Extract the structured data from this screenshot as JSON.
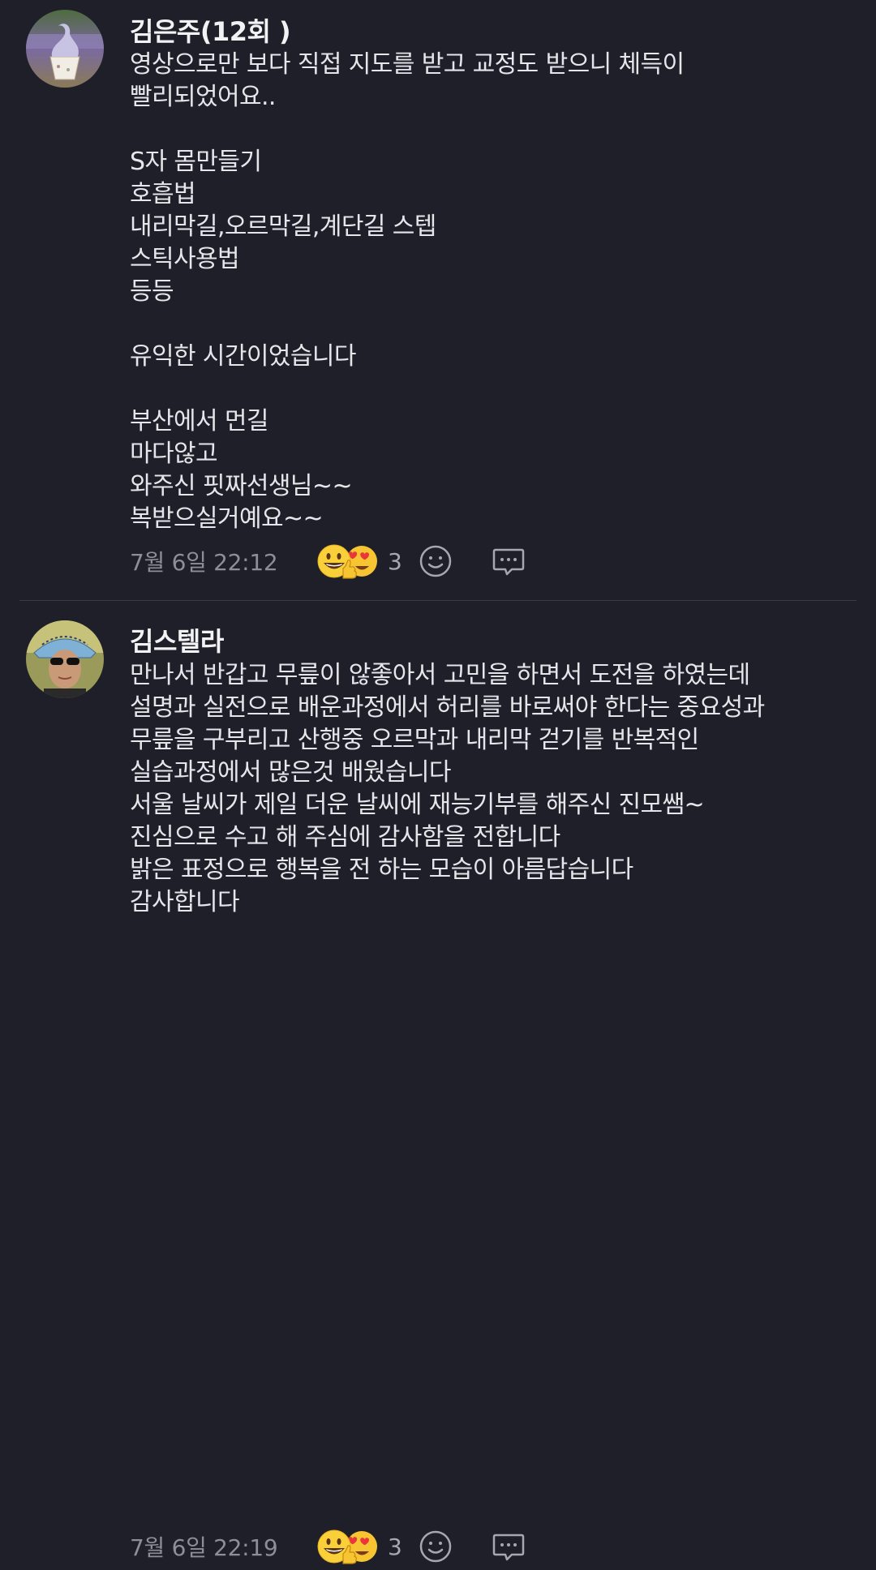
{
  "comments": [
    {
      "author": "김은주(12회 )",
      "lines": [
        "영상으로만 보다 직접 지도를 받고 교정도 받으니 체득이",
        "빨리되었어요..",
        "",
        "S자 몸만들기",
        "호흡법",
        "내리막길,오르막길,계단길 스텝",
        "스틱사용법",
        "등등",
        "",
        "유익한 시간이었습니다",
        "",
        "부산에서 먼길",
        "마다않고",
        "와주신 핏짜선생님~~",
        "복받으실거예요~~"
      ],
      "timestamp": "7월 6일 22:12",
      "reaction_count": "3",
      "reaction_icons": [
        "grinning-emoji",
        "thumbs-up-emoji",
        "heart-eyes-emoji"
      ],
      "actions": [
        "add-reaction-icon",
        "reply-icon"
      ]
    },
    {
      "author": "김스텔라",
      "lines": [
        "만나서 반갑고 무릎이  않좋아서 고민을 하면서 도전을 하였는데",
        "설명과 실전으로 배운과정에서 허리를 바로써야 한다는 중요성과",
        "무릎을 구부리고 산행중 오르막과  내리막 걷기를 반복적인",
        "실습과정에서 많은것 배웠습니다",
        "서울 날씨가 제일 더운 날씨에 재능기부를 해주신 진모쌤~",
        "진심으로 수고 해 주심에 감사함을 전합니다",
        "밝은 표정으로 행복을 전 하는 모습이 아름답습니다",
        "감사합니다"
      ],
      "timestamp": "7월 6일 22:19",
      "reaction_count": "3",
      "reaction_icons": [
        "grinning-emoji",
        "thumbs-up-emoji",
        "heart-eyes-emoji"
      ],
      "actions": [
        "add-reaction-icon",
        "reply-icon"
      ]
    }
  ],
  "colors": {
    "background": "#1f1f29",
    "text": "#e6e6ea",
    "meta": "#8e8e98",
    "emoji_yellow": "#f7c531",
    "divider": "#3a3a46"
  }
}
